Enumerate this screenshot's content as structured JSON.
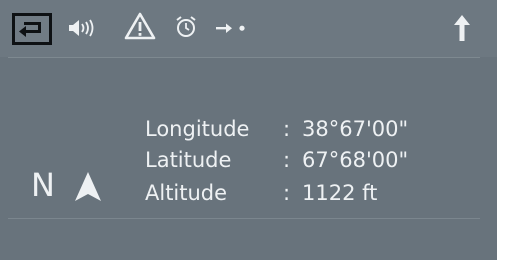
{
  "toolbar": {
    "icons": [
      "back-arrow-icon",
      "speaker-volume-icon",
      "warning-triangle-icon",
      "alarm-clock-icon",
      "route-arrow-dot-icon",
      "up-arrow-icon"
    ]
  },
  "position": {
    "rows": [
      {
        "label": "Longitude",
        "colon": ":",
        "value": "38°67'00\""
      },
      {
        "label": "Latitude",
        "colon": ":",
        "value": "67°68'00\""
      },
      {
        "label": "Altitude",
        "colon": ":",
        "value": "1122 ft"
      }
    ]
  },
  "compass": {
    "heading_letter": "N",
    "arrow_icon": "north-arrow-icon"
  },
  "colors": {
    "screen_bg": "#68737c",
    "text": "#eef1f3",
    "back_border": "#0e1114"
  }
}
